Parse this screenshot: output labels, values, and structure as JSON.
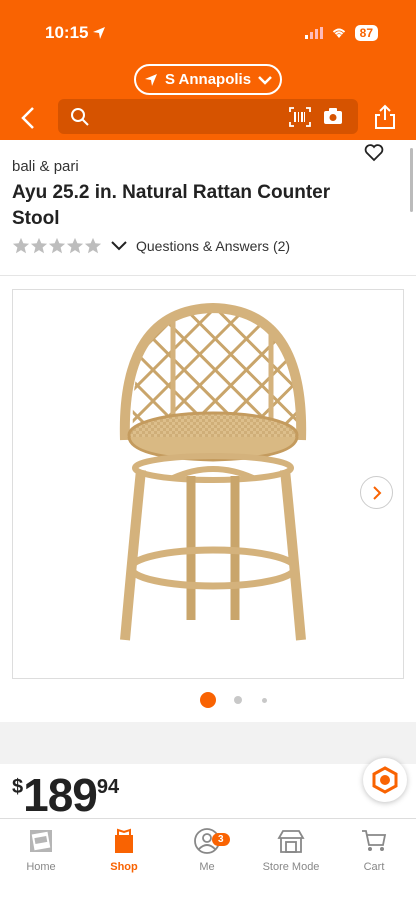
{
  "status_bar": {
    "time": "10:15",
    "battery": "87"
  },
  "header": {
    "store_name": "S Annapolis",
    "search": {
      "placeholder": ""
    },
    "colors": {
      "brand_orange": "#f96302",
      "search_bg": "#d65300"
    }
  },
  "product": {
    "brand": "bali & pari",
    "title": "Ayu 25.2 in. Natural Rattan Counter Stool",
    "rating_stars": 0,
    "qa_label": "Questions & Answers (2)",
    "image_count": 3,
    "active_image_index": 0
  },
  "price": {
    "currency": "$",
    "dollars": "189",
    "cents": "94"
  },
  "tabbar": {
    "tabs": [
      {
        "label": "Home",
        "icon": "home-depot-logo-icon"
      },
      {
        "label": "Shop",
        "icon": "shop-bag-icon",
        "active": true
      },
      {
        "label": "Me",
        "icon": "profile-icon",
        "badge": "3"
      },
      {
        "label": "Store Mode",
        "icon": "store-icon"
      },
      {
        "label": "Cart",
        "icon": "cart-icon"
      }
    ]
  }
}
